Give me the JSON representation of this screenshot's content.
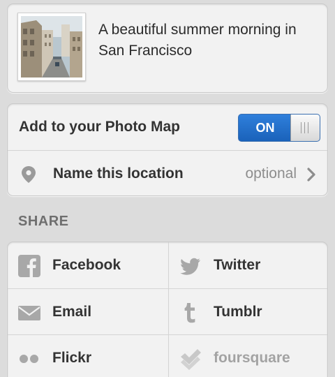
{
  "post": {
    "caption": "A beautiful summer morning in San Francisco",
    "thumbnail_icon": "street-photo-thumbnail"
  },
  "photo_map": {
    "label": "Add to your Photo Map",
    "toggle_state": "ON",
    "toggle_color": "#1f6bc8"
  },
  "location": {
    "label": "Name this location",
    "placeholder": "optional",
    "icon": "location-pin-icon"
  },
  "share": {
    "header": "SHARE",
    "services": [
      {
        "label": "Facebook",
        "icon": "facebook-icon",
        "enabled": true
      },
      {
        "label": "Twitter",
        "icon": "twitter-bird-icon",
        "enabled": true
      },
      {
        "label": "Email",
        "icon": "envelope-icon",
        "enabled": true
      },
      {
        "label": "Tumblr",
        "icon": "tumblr-icon",
        "enabled": true
      },
      {
        "label": "Flickr",
        "icon": "flickr-dots-icon",
        "enabled": true
      },
      {
        "label": "foursquare",
        "icon": "foursquare-check-icon",
        "enabled": false
      }
    ]
  }
}
